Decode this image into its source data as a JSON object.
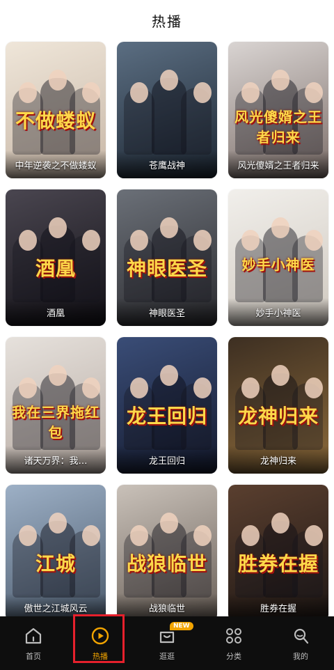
{
  "header": {
    "title": "热播"
  },
  "cards": [
    {
      "caption": "中年逆袭之不做蝼蚁",
      "poster_title": "不做蝼蚁",
      "colors": [
        "#efe6d9",
        "#c7b6a6"
      ]
    },
    {
      "caption": "苍鹰战神",
      "poster_title": "",
      "colors": [
        "#5b6e82",
        "#1d2733"
      ]
    },
    {
      "caption": "风光傻婿之王者归来",
      "poster_title": "风光傻婿之王者归来",
      "colors": [
        "#d9d4d2",
        "#7d6f6a"
      ]
    },
    {
      "caption": "酒凰",
      "poster_title": "酒凰",
      "colors": [
        "#4a4650",
        "#121016"
      ]
    },
    {
      "caption": "神眼医圣",
      "poster_title": "神眼医圣",
      "colors": [
        "#6b7078",
        "#2a2a2e"
      ]
    },
    {
      "caption": "妙手小神医",
      "poster_title": "妙手小神医",
      "colors": [
        "#f1efeb",
        "#cfc8bf"
      ]
    },
    {
      "caption": "诸天万界：我…",
      "poster_title": "我在三界拖红包",
      "colors": [
        "#e6e1dc",
        "#b6aaa2"
      ]
    },
    {
      "caption": "龙王回归",
      "poster_title": "龙王回归",
      "colors": [
        "#3a4d77",
        "#141a2e"
      ]
    },
    {
      "caption": "龙神归来",
      "poster_title": "龙神归来",
      "colors": [
        "#3d2f22",
        "#8c6a3a"
      ]
    },
    {
      "caption": "傲世之江城风云",
      "poster_title": "江城",
      "colors": [
        "#9db0c6",
        "#4b5a6c"
      ]
    },
    {
      "caption": "战狼临世",
      "poster_title": "战狼临世",
      "colors": [
        "#c9c1b9",
        "#6a6058"
      ]
    },
    {
      "caption": "胜券在握",
      "poster_title": "胜券在握",
      "colors": [
        "#5a3f2f",
        "#1e1714"
      ]
    }
  ],
  "tabbar": {
    "items": [
      {
        "label": "首页",
        "icon": "home-icon"
      },
      {
        "label": "热播",
        "icon": "play-circle-icon",
        "active": true
      },
      {
        "label": "逛逛",
        "icon": "shopping-bag-icon",
        "badge": "NEW"
      },
      {
        "label": "分类",
        "icon": "grid-icon"
      },
      {
        "label": "我的",
        "icon": "user-icon"
      }
    ],
    "active_color": "#f2a400",
    "inactive_color": "#bdbdbd"
  }
}
